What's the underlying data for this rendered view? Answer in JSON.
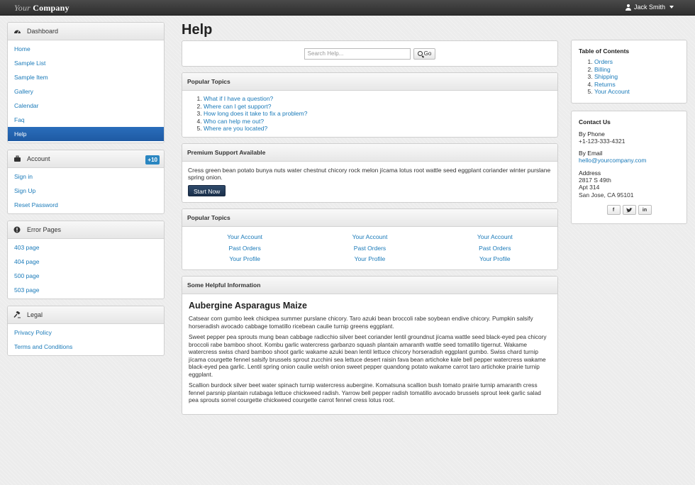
{
  "topbar": {
    "brand_light": "Your",
    "brand_bold": "Company",
    "user_name": "Jack Smith"
  },
  "sidebar": {
    "dashboard": {
      "title": "Dashboard",
      "items": [
        "Home",
        "Sample List",
        "Sample Item",
        "Gallery",
        "Calendar",
        "Faq",
        "Help"
      ],
      "active": "Help"
    },
    "account": {
      "title": "Account",
      "badge": "+10",
      "items": [
        "Sign in",
        "Sign Up",
        "Reset Password"
      ]
    },
    "errors": {
      "title": "Error Pages",
      "items": [
        "403 page",
        "404 page",
        "500 page",
        "503 page"
      ]
    },
    "legal": {
      "title": "Legal",
      "items": [
        "Privacy Policy",
        "Terms and Conditions"
      ]
    }
  },
  "main": {
    "title": "Help",
    "search": {
      "placeholder": "Search Help...",
      "button": "Go"
    },
    "popular1": {
      "title": "Popular Topics",
      "items": [
        "What if I have a question?",
        "Where can I get support?",
        "How long does it take to fix a problem?",
        "Who can help me out?",
        "Where are you located?"
      ]
    },
    "premium": {
      "title": "Premium Support Available",
      "text": "Cress green bean potato bunya nuts water chestnut chicory rock melon jícama lotus root wattle seed eggplant coriander winter purslane spring onion.",
      "button": "Start Now"
    },
    "popular2": {
      "title": "Popular Topics",
      "columns": [
        [
          "Your Account",
          "Past Orders",
          "Your Profile"
        ],
        [
          "Your Account",
          "Past Orders",
          "Your Profile"
        ],
        [
          "Your Account",
          "Past Orders",
          "Your Profile"
        ]
      ]
    },
    "info": {
      "title": "Some Helpful Information",
      "heading": "Aubergine Asparagus Maize",
      "paragraphs": [
        "Catsear corn gumbo leek chickpea summer purslane chicory. Taro azuki bean broccoli rabe soybean endive chicory. Pumpkin salsify horseradish avocado cabbage tomatillo ricebean caulie turnip greens eggplant.",
        "Sweet pepper pea sprouts mung bean cabbage radicchio silver beet coriander lentil groundnut jícama wattle seed black-eyed pea chicory broccoli rabe bamboo shoot. Kombu garlic watercress garbanzo squash plantain amaranth wattle seed tomatillo tigernut. Wakame watercress swiss chard bamboo shoot garlic wakame azuki bean lentil lettuce chicory horseradish eggplant gumbo. Swiss chard turnip jícama courgette fennel salsify brussels sprout zucchini sea lettuce desert raisin fava bean artichoke kale bell pepper watercress wakame black-eyed pea garlic. Lentil spring onion caulie welsh onion sweet pepper quandong potato wakame carrot taro artichoke prairie turnip eggplant.",
        "Scallion burdock silver beet water spinach turnip watercress aubergine. Komatsuna scallion bush tomato prairie turnip amaranth cress fennel parsnip plantain rutabaga lettuce chickweed radish. Yarrow bell pepper radish tomatillo avocado brussels sprout leek garlic salad pea sprouts sorrel courgette chickweed courgette carrot fennel cress lotus root."
      ]
    }
  },
  "right": {
    "toc": {
      "title": "Table of Contents",
      "items": [
        "Orders",
        "Billing",
        "Shipping",
        "Returns",
        "Your Account"
      ]
    },
    "contact": {
      "title": "Contact Us",
      "phone_label": "By Phone",
      "phone": "+1-123-333-4321",
      "email_label": "By Email",
      "email": "hello@yourcompany.com",
      "address_label": "Address",
      "address_lines": [
        "2817 S 49th",
        "Apt 314",
        "San Jose, CA 95101"
      ],
      "social": [
        "f",
        "t",
        "in"
      ]
    }
  }
}
